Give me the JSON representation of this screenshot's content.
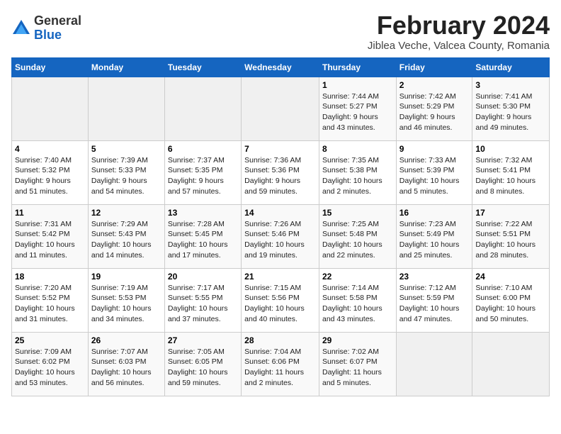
{
  "header": {
    "logo_general": "General",
    "logo_blue": "Blue",
    "title": "February 2024",
    "subtitle": "Jiblea Veche, Valcea County, Romania"
  },
  "calendar": {
    "days_of_week": [
      "Sunday",
      "Monday",
      "Tuesday",
      "Wednesday",
      "Thursday",
      "Friday",
      "Saturday"
    ],
    "weeks": [
      [
        {
          "day": "",
          "info": ""
        },
        {
          "day": "",
          "info": ""
        },
        {
          "day": "",
          "info": ""
        },
        {
          "day": "",
          "info": ""
        },
        {
          "day": "1",
          "info": "Sunrise: 7:44 AM\nSunset: 5:27 PM\nDaylight: 9 hours\nand 43 minutes."
        },
        {
          "day": "2",
          "info": "Sunrise: 7:42 AM\nSunset: 5:29 PM\nDaylight: 9 hours\nand 46 minutes."
        },
        {
          "day": "3",
          "info": "Sunrise: 7:41 AM\nSunset: 5:30 PM\nDaylight: 9 hours\nand 49 minutes."
        }
      ],
      [
        {
          "day": "4",
          "info": "Sunrise: 7:40 AM\nSunset: 5:32 PM\nDaylight: 9 hours\nand 51 minutes."
        },
        {
          "day": "5",
          "info": "Sunrise: 7:39 AM\nSunset: 5:33 PM\nDaylight: 9 hours\nand 54 minutes."
        },
        {
          "day": "6",
          "info": "Sunrise: 7:37 AM\nSunset: 5:35 PM\nDaylight: 9 hours\nand 57 minutes."
        },
        {
          "day": "7",
          "info": "Sunrise: 7:36 AM\nSunset: 5:36 PM\nDaylight: 9 hours\nand 59 minutes."
        },
        {
          "day": "8",
          "info": "Sunrise: 7:35 AM\nSunset: 5:38 PM\nDaylight: 10 hours\nand 2 minutes."
        },
        {
          "day": "9",
          "info": "Sunrise: 7:33 AM\nSunset: 5:39 PM\nDaylight: 10 hours\nand 5 minutes."
        },
        {
          "day": "10",
          "info": "Sunrise: 7:32 AM\nSunset: 5:41 PM\nDaylight: 10 hours\nand 8 minutes."
        }
      ],
      [
        {
          "day": "11",
          "info": "Sunrise: 7:31 AM\nSunset: 5:42 PM\nDaylight: 10 hours\nand 11 minutes."
        },
        {
          "day": "12",
          "info": "Sunrise: 7:29 AM\nSunset: 5:43 PM\nDaylight: 10 hours\nand 14 minutes."
        },
        {
          "day": "13",
          "info": "Sunrise: 7:28 AM\nSunset: 5:45 PM\nDaylight: 10 hours\nand 17 minutes."
        },
        {
          "day": "14",
          "info": "Sunrise: 7:26 AM\nSunset: 5:46 PM\nDaylight: 10 hours\nand 19 minutes."
        },
        {
          "day": "15",
          "info": "Sunrise: 7:25 AM\nSunset: 5:48 PM\nDaylight: 10 hours\nand 22 minutes."
        },
        {
          "day": "16",
          "info": "Sunrise: 7:23 AM\nSunset: 5:49 PM\nDaylight: 10 hours\nand 25 minutes."
        },
        {
          "day": "17",
          "info": "Sunrise: 7:22 AM\nSunset: 5:51 PM\nDaylight: 10 hours\nand 28 minutes."
        }
      ],
      [
        {
          "day": "18",
          "info": "Sunrise: 7:20 AM\nSunset: 5:52 PM\nDaylight: 10 hours\nand 31 minutes."
        },
        {
          "day": "19",
          "info": "Sunrise: 7:19 AM\nSunset: 5:53 PM\nDaylight: 10 hours\nand 34 minutes."
        },
        {
          "day": "20",
          "info": "Sunrise: 7:17 AM\nSunset: 5:55 PM\nDaylight: 10 hours\nand 37 minutes."
        },
        {
          "day": "21",
          "info": "Sunrise: 7:15 AM\nSunset: 5:56 PM\nDaylight: 10 hours\nand 40 minutes."
        },
        {
          "day": "22",
          "info": "Sunrise: 7:14 AM\nSunset: 5:58 PM\nDaylight: 10 hours\nand 43 minutes."
        },
        {
          "day": "23",
          "info": "Sunrise: 7:12 AM\nSunset: 5:59 PM\nDaylight: 10 hours\nand 47 minutes."
        },
        {
          "day": "24",
          "info": "Sunrise: 7:10 AM\nSunset: 6:00 PM\nDaylight: 10 hours\nand 50 minutes."
        }
      ],
      [
        {
          "day": "25",
          "info": "Sunrise: 7:09 AM\nSunset: 6:02 PM\nDaylight: 10 hours\nand 53 minutes."
        },
        {
          "day": "26",
          "info": "Sunrise: 7:07 AM\nSunset: 6:03 PM\nDaylight: 10 hours\nand 56 minutes."
        },
        {
          "day": "27",
          "info": "Sunrise: 7:05 AM\nSunset: 6:05 PM\nDaylight: 10 hours\nand 59 minutes."
        },
        {
          "day": "28",
          "info": "Sunrise: 7:04 AM\nSunset: 6:06 PM\nDaylight: 11 hours\nand 2 minutes."
        },
        {
          "day": "29",
          "info": "Sunrise: 7:02 AM\nSunset: 6:07 PM\nDaylight: 11 hours\nand 5 minutes."
        },
        {
          "day": "",
          "info": ""
        },
        {
          "day": "",
          "info": ""
        }
      ]
    ]
  }
}
